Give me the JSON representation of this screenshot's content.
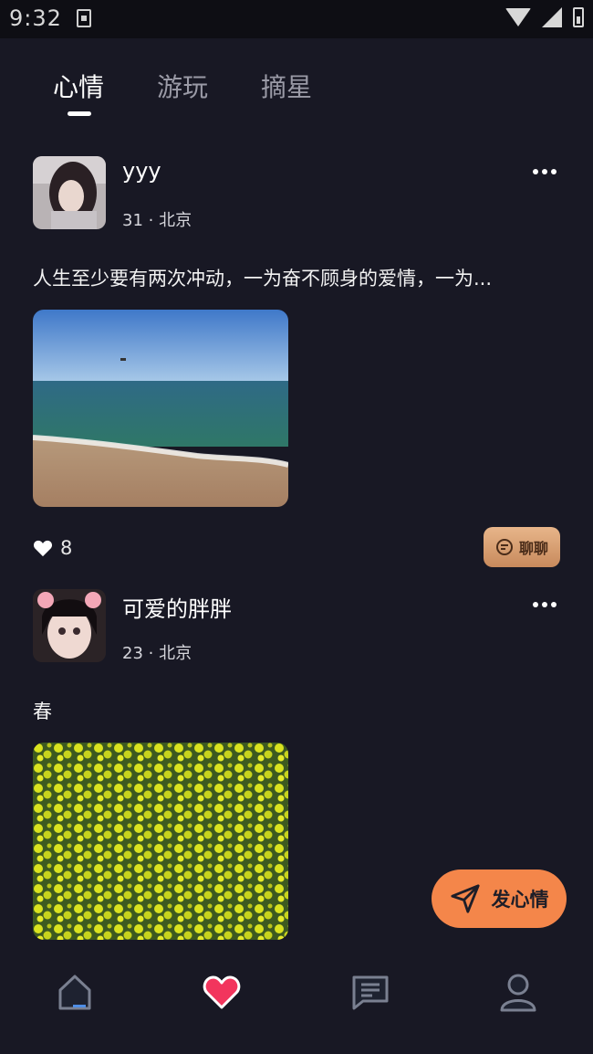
{
  "status_bar": {
    "time": "9:32"
  },
  "tabs": [
    "心情",
    "游玩",
    "摘星"
  ],
  "posts": [
    {
      "username": "yyy",
      "meta": "31 · 北京",
      "text": "人生至少要有两次冲动，一为奋不顾身的爱情，一为...",
      "likes": "8",
      "chat_label": "聊聊"
    },
    {
      "username": "可爱的胖胖",
      "meta": "23 · 北京",
      "text": "春"
    }
  ],
  "fab_label": "发心情",
  "colors": {
    "background": "#181824",
    "accent": "#f4864a",
    "like_active": "#f2355d",
    "chat_button": "#d9a072"
  },
  "bottom_nav": [
    "home-icon",
    "heart-icon",
    "message-icon",
    "profile-icon"
  ]
}
